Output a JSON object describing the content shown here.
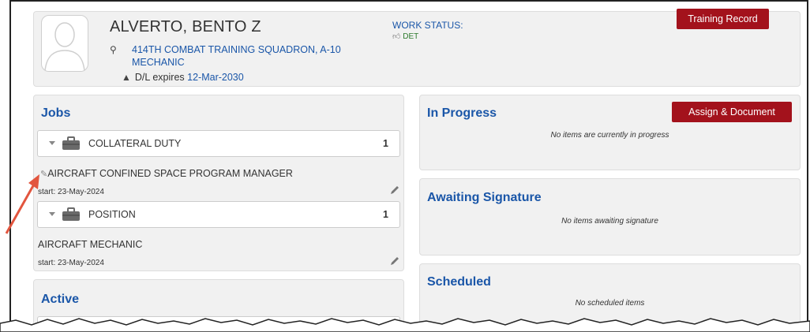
{
  "profile": {
    "name": "ALVERTO, BENTO Z",
    "unit": "414TH COMBAT TRAINING SQUADRON, A-10 MECHANIC",
    "dl_prefix": "D/L expires",
    "dl_date": "12-Mar-2030",
    "work_status_label": "WORK STATUS:",
    "work_status_value": "DET",
    "training_record_button": "Training Record"
  },
  "jobs": {
    "title": "Jobs",
    "groups": [
      {
        "label": "COLLATERAL DUTY",
        "count": "1",
        "item": "AIRCRAFT CONFINED SPACE PROGRAM MANAGER",
        "start": "start: 23-May-2024"
      },
      {
        "label": "POSITION",
        "count": "1",
        "item": "AIRCRAFT MECHANIC",
        "start": "start: 23-May-2024"
      }
    ]
  },
  "active": {
    "title": "Active"
  },
  "in_progress": {
    "title": "In Progress",
    "button": "Assign & Document",
    "empty": "No items are currently in progress"
  },
  "awaiting_signature": {
    "title": "Awaiting Signature",
    "empty": "No items awaiting signature"
  },
  "scheduled": {
    "title": "Scheduled",
    "empty": "No scheduled items"
  },
  "colors": {
    "accent": "#1a56a8",
    "button_red": "#a3121c",
    "panel_bg": "#f1f1f1",
    "callout_arrow": "#e2553e"
  },
  "icons": [
    "avatar-placeholder-icon",
    "map-pin-icon",
    "road-icon",
    "thumbs-up-icon",
    "chevron-down-icon",
    "briefcase-icon",
    "tag-icon",
    "pencil-icon"
  ]
}
